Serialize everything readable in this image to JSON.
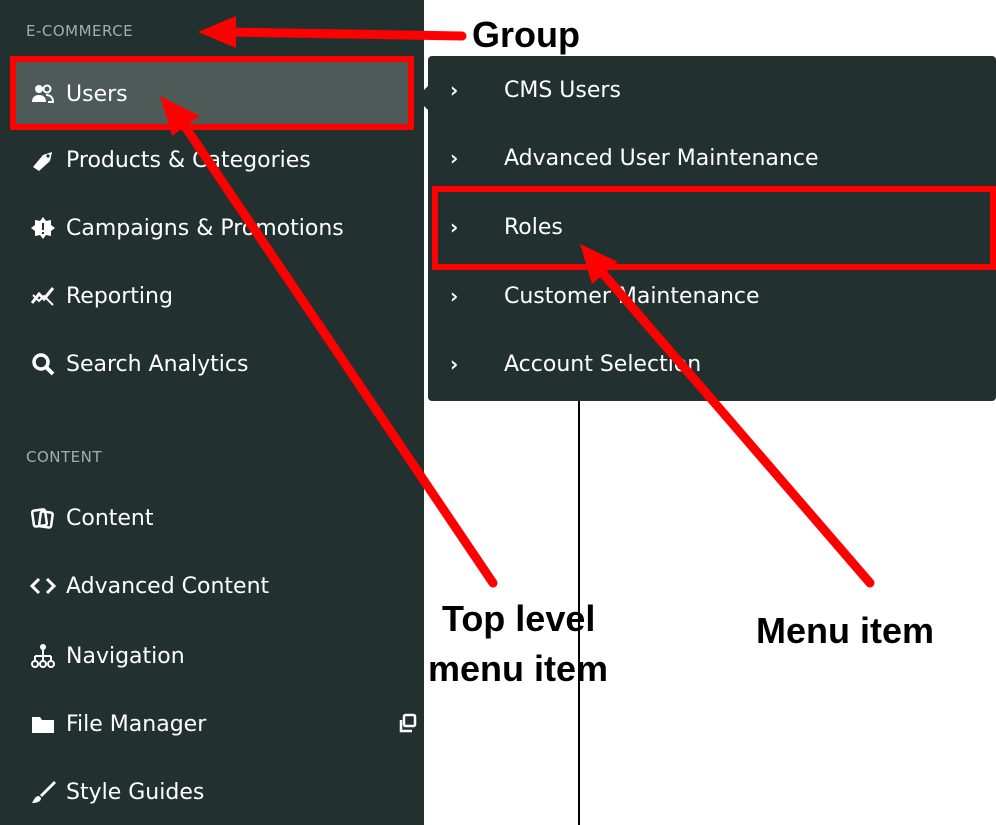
{
  "sidebar": {
    "groups": [
      {
        "label": "E-COMMERCE",
        "items": [
          {
            "label": "Users",
            "icon": "users-icon",
            "active": true
          },
          {
            "label": "Products & Categories",
            "icon": "tag-icon"
          },
          {
            "label": "Campaigns & Promotions",
            "icon": "badge-icon"
          },
          {
            "label": "Reporting",
            "icon": "trend-icon"
          },
          {
            "label": "Search Analytics",
            "icon": "search-icon"
          }
        ]
      },
      {
        "label": "CONTENT",
        "items": [
          {
            "label": "Content",
            "icon": "content-icon"
          },
          {
            "label": "Advanced Content",
            "icon": "code-icon"
          },
          {
            "label": "Navigation",
            "icon": "sitemap-icon"
          },
          {
            "label": "File Manager",
            "icon": "folder-icon",
            "external_icon": "external-link-icon"
          },
          {
            "label": "Style Guides",
            "icon": "brush-icon"
          }
        ]
      }
    ]
  },
  "submenu": {
    "items": [
      {
        "label": "CMS Users"
      },
      {
        "label": "Advanced User Maintenance"
      },
      {
        "label": "Roles"
      },
      {
        "label": "Customer Maintenance"
      },
      {
        "label": "Account Selection"
      }
    ]
  },
  "annotations": {
    "group": "Group",
    "top_level_line1": "Top level",
    "top_level_line2": "menu item",
    "menu_item": "Menu item"
  },
  "colors": {
    "sidebar_bg": "#233030",
    "active_bg": "#4e5a58",
    "highlight": "#ff0000",
    "group_label": "#9fb0ae"
  }
}
